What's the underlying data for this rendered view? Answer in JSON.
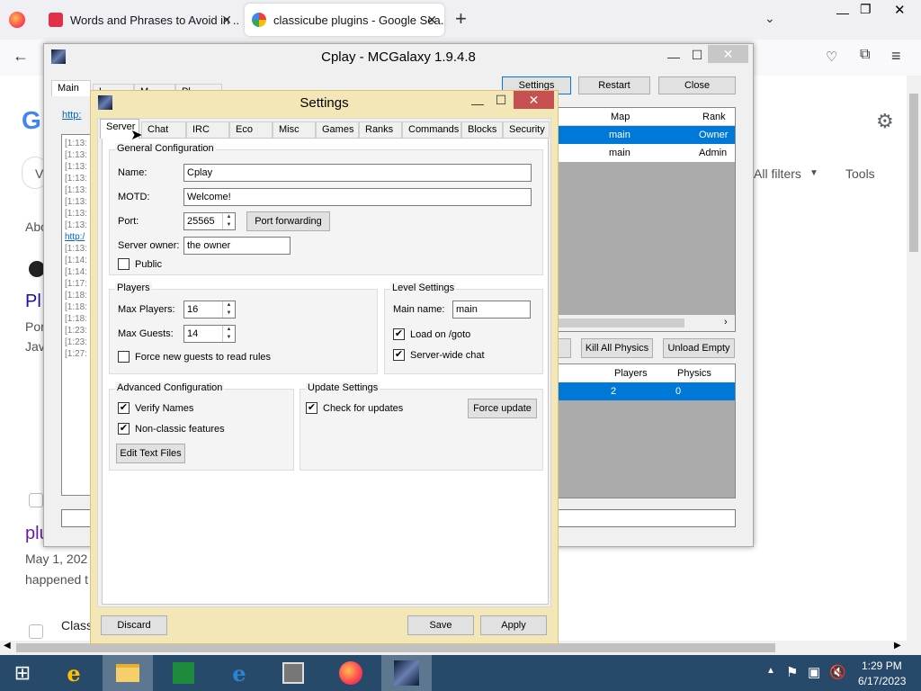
{
  "browser": {
    "tabs": [
      {
        "title": "Words and Phrases to Avoid in ..."
      },
      {
        "title": "classicube plugins - Google Sea..."
      }
    ],
    "new_tab": "+"
  },
  "google": {
    "filters": "All filters",
    "tools": "Tools",
    "about": "Abo",
    "result_title_1": "Pl",
    "result_line_1": "Por",
    "result_line_2": "Jav",
    "result_title_2": "plu",
    "result_date": "May 1, 202",
    "result_text": "happened t",
    "result_site": "Class"
  },
  "mcgalaxy": {
    "title": "Cplay - MCGalaxy 1.9.4.8",
    "tabs": [
      "Main",
      "L",
      "M",
      "Pl"
    ],
    "buttons": {
      "settings": "Settings",
      "restart": "Restart",
      "close": "Close",
      "kill_physics": "Kill All Physics",
      "unload_empty": "Unload Empty"
    },
    "url_stub": "http:",
    "log_lines": [
      "[1:13:",
      "[1:13:",
      "[1:13:",
      "[1:13:",
      "[1:13:",
      "[1:13:",
      "[1:13:",
      "[1:13:",
      "http:/",
      "[1:13:",
      "[1:14:",
      "[1:14:",
      "[1:17:",
      "[1:18:",
      "[1:18:",
      "[1:18:",
      "[1:23:",
      "[1:23:",
      "[1:27:"
    ],
    "players_table": {
      "headers": [
        "Map",
        "Rank"
      ],
      "rows": [
        [
          "main",
          "Owner"
        ],
        [
          "main",
          "Admin"
        ]
      ]
    },
    "maps_table": {
      "headers": [
        "Players",
        "Physics"
      ],
      "rows": [
        [
          "2",
          "0"
        ]
      ]
    }
  },
  "settings": {
    "title": "Settings",
    "tabs": [
      "Server",
      "Chat",
      "IRC",
      "Eco",
      "Misc",
      "Games",
      "Ranks",
      "Commands",
      "Blocks",
      "Security"
    ],
    "general": {
      "legend": "General Configuration",
      "name_label": "Name:",
      "name_value": "Cplay",
      "motd_label": "MOTD:",
      "motd_value": "Welcome!",
      "port_label": "Port:",
      "port_value": "25565",
      "port_forwarding": "Port forwarding",
      "owner_label": "Server owner:",
      "owner_value": "the owner",
      "public_label": "Public"
    },
    "players": {
      "legend": "Players",
      "max_players_label": "Max Players:",
      "max_players_value": "16",
      "max_guests_label": "Max Guests:",
      "max_guests_value": "14",
      "force_rules_label": "Force new guests to read rules"
    },
    "level": {
      "legend": "Level Settings",
      "main_name_label": "Main name:",
      "main_name_value": "main",
      "load_goto_label": "Load on /goto",
      "server_chat_label": "Server-wide chat"
    },
    "advanced": {
      "legend": "Advanced Configuration",
      "verify_names_label": "Verify Names",
      "nonclassic_label": "Non-classic features",
      "edit_text_files": "Edit Text Files"
    },
    "update": {
      "legend": "Update Settings",
      "check_updates_label": "Check for updates",
      "force_update": "Force update"
    },
    "footer": {
      "discard": "Discard",
      "save": "Save",
      "apply": "Apply"
    }
  },
  "taskbar": {
    "time": "1:29 PM",
    "date": "6/17/2023"
  }
}
